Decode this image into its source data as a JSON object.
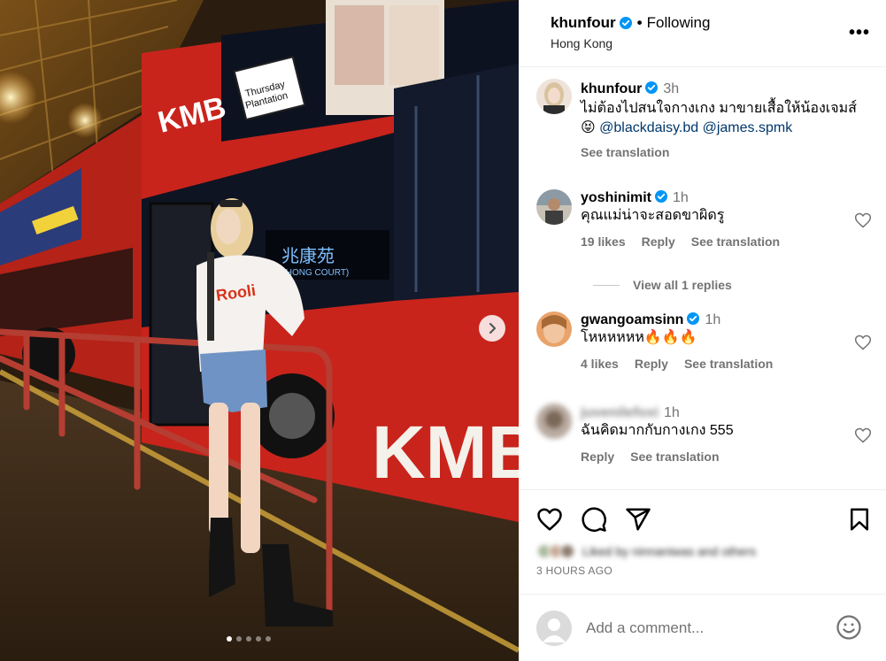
{
  "header": {
    "username": "khunfour",
    "follow_status": "Following",
    "location": "Hong Kong",
    "more_label": "•••"
  },
  "caption": {
    "username": "khunfour",
    "time": "3h",
    "text": "ไม่ต้องไปสนใจกางเกง มาขายเสื้อให้น้องเจมส์",
    "emoji": "😝",
    "mentions": [
      "@blackdaisy.bd",
      "@james.spmk"
    ],
    "see_translation": "See translation"
  },
  "comments": [
    {
      "username": "yoshinimit",
      "time": "1h",
      "text": "คุณแม่น่าจะสอดขาผิดรู",
      "likes": "19 likes",
      "reply": "Reply",
      "see_translation": "See translation",
      "view_replies": "View all 1 replies"
    },
    {
      "username": "gwangoamsinn",
      "time": "1h",
      "text": "โหหหหหห🔥🔥🔥",
      "likes": "4 likes",
      "reply": "Reply",
      "see_translation": "See translation"
    },
    {
      "username": "juvenilefoxi",
      "time": "1h",
      "text": "ฉันคิดมากกับกางเกง 555",
      "reply": "Reply",
      "see_translation": "See translation"
    }
  ],
  "liked_by": "Liked by ninnaniwas and others",
  "posted_ago": "3 HOURS AGO",
  "comment_placeholder": "Add a comment...",
  "photo": {
    "bus_ad_text": "Thursday Plantation",
    "bus_brand_top": "KMB",
    "bus_brand_side": "KMB",
    "destination_text": "兆康苑",
    "destination_sub": "(SIU HONG COURT)",
    "shirt_text": "Rooli",
    "carousel_count": 5,
    "carousel_active": 0
  },
  "colors": {
    "verified_blue": "#0095f6",
    "mention_blue": "#00376b",
    "muted_text": "#737373",
    "bus_red": "#c8241c"
  }
}
